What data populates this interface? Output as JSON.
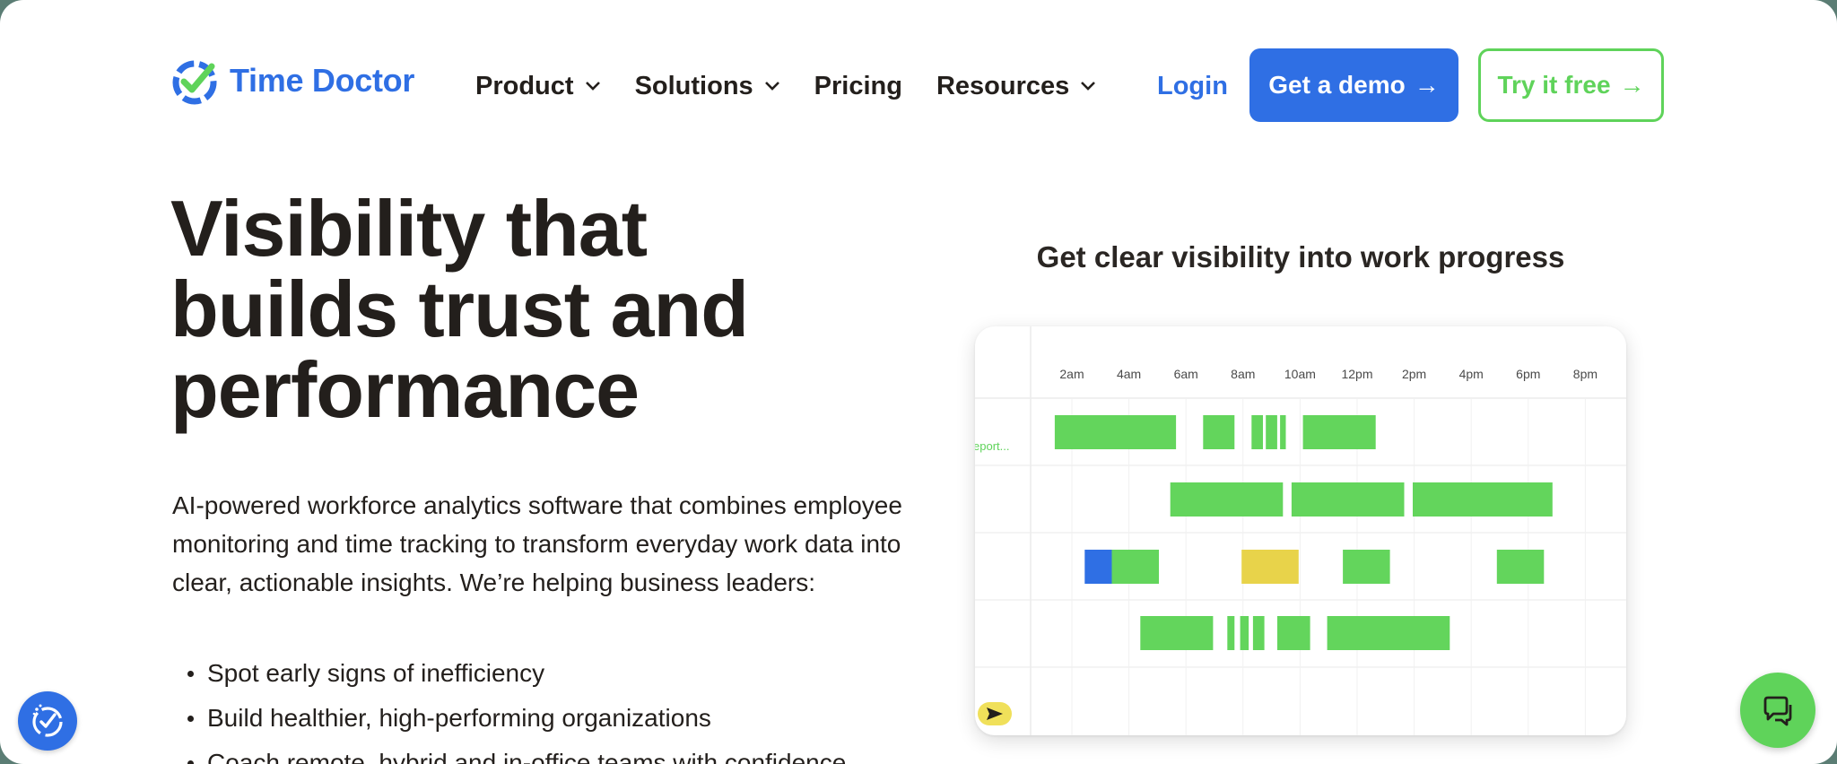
{
  "brand": {
    "name": "Time Doctor",
    "color": "#2f6fe4",
    "accent": "#5fd35a"
  },
  "nav": {
    "items": [
      {
        "label": "Product",
        "has_dropdown": true
      },
      {
        "label": "Solutions",
        "has_dropdown": true
      },
      {
        "label": "Pricing",
        "has_dropdown": false
      },
      {
        "label": "Resources",
        "has_dropdown": true
      }
    ],
    "login": "Login",
    "demo_button": "Get a demo",
    "try_button": "Try it free",
    "arrow_icon": "arrow-right-icon"
  },
  "hero": {
    "title": "Visibility that builds trust and performance",
    "description": "AI-powered workforce analytics software that combines employee monitoring and time tracking to transform everyday work data into clear, actionable insights. We’re helping business leaders:",
    "bullets": [
      "Spot early signs of inefficiency",
      "Build healthier, high-performing organizations",
      "Coach remote, hybrid and in-office teams with confidence"
    ]
  },
  "chart": {
    "heading": "Get clear visibility into work progress",
    "time_labels": [
      "2am",
      "4am",
      "6am",
      "8am",
      "10am",
      "12pm",
      "2pm",
      "4pm",
      "6pm",
      "8pm"
    ],
    "row_label": "eport...",
    "colors": {
      "productive": "#63d55c",
      "idle": "#e8d34a",
      "manual": "#2f6fe4"
    },
    "rows": [
      {
        "segments": [
          {
            "start": 1.4,
            "end": 5.65,
            "color": "productive"
          },
          {
            "start": 6.6,
            "end": 7.7,
            "color": "productive"
          },
          {
            "start": 8.3,
            "end": 8.7,
            "color": "productive"
          },
          {
            "start": 8.8,
            "end": 9.2,
            "color": "productive"
          },
          {
            "start": 9.3,
            "end": 9.5,
            "color": "productive"
          },
          {
            "start": 10.1,
            "end": 12.65,
            "color": "productive"
          }
        ]
      },
      {
        "segments": [
          {
            "start": 5.45,
            "end": 9.4,
            "color": "productive"
          },
          {
            "start": 9.7,
            "end": 13.65,
            "color": "productive"
          },
          {
            "start": 13.95,
            "end": 18.85,
            "color": "productive"
          }
        ]
      },
      {
        "segments": [
          {
            "start": 2.45,
            "end": 3.4,
            "color": "manual"
          },
          {
            "start": 3.4,
            "end": 5.05,
            "color": "productive"
          },
          {
            "start": 7.95,
            "end": 9.95,
            "color": "idle"
          },
          {
            "start": 11.5,
            "end": 13.15,
            "color": "productive"
          },
          {
            "start": 16.9,
            "end": 18.55,
            "color": "productive"
          }
        ]
      },
      {
        "segments": [
          {
            "start": 4.4,
            "end": 6.95,
            "color": "productive"
          },
          {
            "start": 7.45,
            "end": 7.7,
            "color": "productive"
          },
          {
            "start": 7.9,
            "end": 8.2,
            "color": "productive"
          },
          {
            "start": 8.35,
            "end": 8.75,
            "color": "productive"
          },
          {
            "start": 9.2,
            "end": 10.35,
            "color": "productive"
          },
          {
            "start": 10.95,
            "end": 15.25,
            "color": "productive"
          }
        ]
      }
    ],
    "play_icon": "send-arrow-icon"
  },
  "floating": {
    "left_icon": "time-doctor-badge-icon",
    "right_icon": "chat-bubbles-icon"
  }
}
